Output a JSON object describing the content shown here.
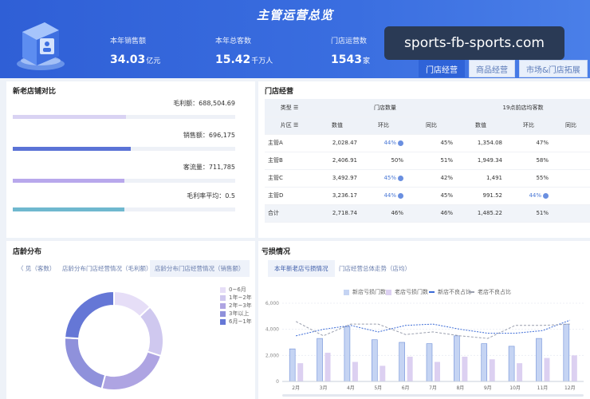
{
  "header": {
    "title": "主管运营总览",
    "kpis": [
      {
        "label": "本年销售额",
        "value": "34.03",
        "unit": "亿元"
      },
      {
        "label": "本年总客数",
        "value": "15.42",
        "unit": "千万人"
      },
      {
        "label": "门店运营数",
        "value": "1543",
        "unit": "家"
      }
    ],
    "watermark": "sports-fb-sports.com",
    "tabs": [
      "门店经营",
      "商品经营",
      "市场&门店拓展"
    ],
    "active_tab": 0
  },
  "compare": {
    "title": "新老店铺对比",
    "metrics": [
      {
        "label": "毛利额：688,504.69",
        "fill": 0.51,
        "color": "#d9d3f3"
      },
      {
        "label": "销售额：696,175",
        "fill": 0.53,
        "color": "#5b73d6"
      },
      {
        "label": "客流量：711,785",
        "fill": 0.5,
        "color": "#b8a8ec"
      },
      {
        "label": "毛利率平均：0.5",
        "fill": 0.5,
        "color": "#6fb8cf"
      }
    ]
  },
  "stores": {
    "title": "门店经营",
    "head1": [
      "类型",
      "门店数量",
      "19点前店均客数"
    ],
    "head2": [
      "片区",
      "数值",
      "环比",
      "同比",
      "数值",
      "环比",
      "同比"
    ],
    "rows": [
      {
        "name": "主管A",
        "v1": "2,028.47",
        "h1": "44%",
        "d1": true,
        "t1": "45%",
        "v2": "1,354.08",
        "h2": "47%",
        "d2": false
      },
      {
        "name": "主管B",
        "v1": "2,406.91",
        "h1": "50%",
        "d1": false,
        "t1": "51%",
        "v2": "1,949.34",
        "h2": "58%",
        "d2": false
      },
      {
        "name": "主管C",
        "v1": "3,492.97",
        "h1": "45%",
        "d1": true,
        "t1": "42%",
        "v2": "1,491",
        "h2": "55%",
        "d2": false
      },
      {
        "name": "主管D",
        "v1": "3,236.17",
        "h1": "44%",
        "d1": true,
        "t1": "45%",
        "v2": "991.52",
        "h2": "44%",
        "d2": true
      },
      {
        "name": "合计",
        "v1": "2,718.74",
        "h1": "46%",
        "d1": false,
        "t1": "46%",
        "v2": "1,485.22",
        "h2": "51%",
        "d2": false
      }
    ]
  },
  "age": {
    "title": "店龄分布",
    "tabs": [
      "〈 见（客数）",
      "店龄分布门店经营情况（毛利额）",
      "店龄分布门店经营情况（销售额）"
    ],
    "active_tab": 2,
    "legend": [
      "0~6月",
      "1年~2年",
      "2年~3年",
      "3年以上",
      "6月~1年"
    ],
    "chart_data": {
      "type": "pie",
      "donut": true,
      "categories": [
        "0~6月",
        "1年~2年",
        "2年~3年",
        "3年以上",
        "6月~1年"
      ],
      "values": [
        13,
        17,
        24,
        22,
        24
      ],
      "colors": [
        "#e6def7",
        "#cfc8ef",
        "#aea4e2",
        "#8f91db",
        "#6577d6"
      ]
    }
  },
  "loss": {
    "title": "亏损情况",
    "tabs": [
      "本年新老店亏损情况",
      "门店经营总体走势（店均）"
    ],
    "active_tab": 0,
    "legend": [
      "新店亏损门数",
      "老店亏损门数",
      "新店不良占比",
      "老店不良占比"
    ],
    "colors": {
      "new_bar": "#c5d4f3",
      "old_bar": "#dcd0f1",
      "new_line": "#3a6ad6",
      "old_line": "#9a9fae"
    },
    "chart_data": {
      "type": "bar",
      "categories": [
        "2月",
        "3月",
        "4月",
        "5月",
        "6月",
        "7月",
        "8月",
        "9月",
        "10月",
        "11月",
        "12月"
      ],
      "ylim": [
        0,
        6000
      ],
      "yticks": [
        "0",
        "2,000",
        "4,000",
        "6,000"
      ],
      "series": [
        {
          "name": "新店亏损门数",
          "values": [
            2500,
            3300,
            4200,
            3200,
            3000,
            2900,
            3500,
            2900,
            2700,
            3300,
            4400
          ]
        },
        {
          "name": "老店亏损门数",
          "values": [
            1400,
            2200,
            1500,
            1200,
            1900,
            1500,
            1900,
            1700,
            1400,
            1800,
            2000
          ]
        },
        {
          "name": "新店不良占比",
          "values": [
            3500,
            4000,
            4300,
            3800,
            4300,
            4400,
            4000,
            3700,
            3700,
            3900,
            4700
          ]
        },
        {
          "name": "老店不良占比",
          "values": [
            4600,
            3500,
            4400,
            4400,
            3600,
            3800,
            3500,
            3300,
            4300,
            4300,
            4400
          ]
        }
      ]
    }
  }
}
